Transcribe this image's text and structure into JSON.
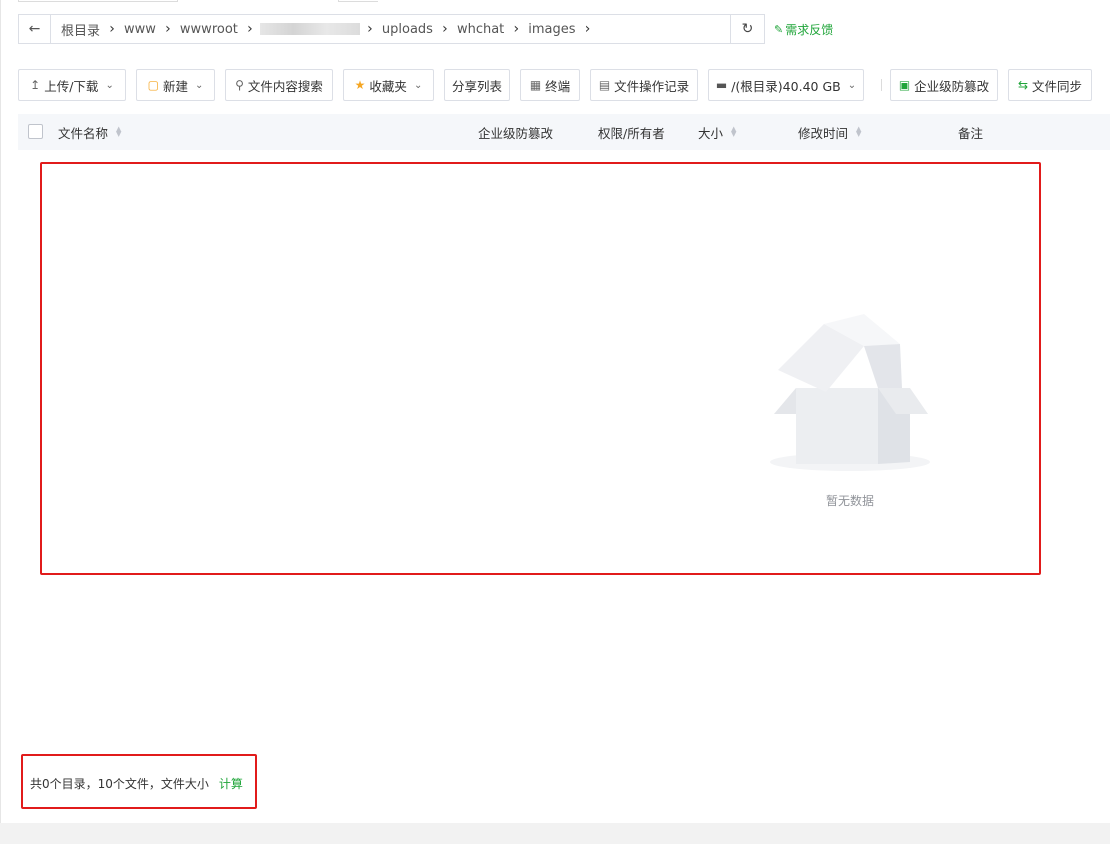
{
  "breadcrumb": {
    "back_icon": "arrow-left-icon",
    "items": [
      "根目录",
      "www",
      "wwwroot",
      "",
      "uploads",
      "whchat",
      "images"
    ],
    "refresh_icon": "refresh-icon"
  },
  "feedback": {
    "label": "需求反馈",
    "icon": "feedback-icon"
  },
  "toolbar": {
    "upload_download": "上传/下载",
    "new": "新建",
    "content_search": "文件内容搜索",
    "favorites": "收藏夹",
    "share_list": "分享列表",
    "terminal": "终端",
    "operation_log": "文件操作记录",
    "disk": "/(根目录)40.40 GB",
    "tamper_proof": "企业级防篡改",
    "file_sync": "文件同步"
  },
  "table": {
    "columns": {
      "name": "文件名称",
      "tamper": "企业级防篡改",
      "permission": "权限/所有者",
      "size": "大小",
      "mtime": "修改时间",
      "remark": "备注"
    },
    "empty_text": "暂无数据"
  },
  "footer": {
    "summary": "共0个目录，10个文件，文件大小",
    "calc_label": "计算"
  },
  "colors": {
    "accent": "#20a53a",
    "highlight": "#e11b1b"
  }
}
